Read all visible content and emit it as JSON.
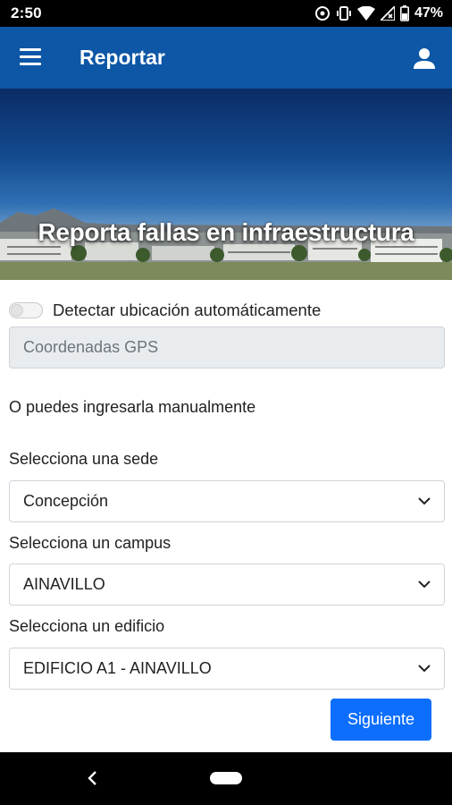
{
  "status_bar": {
    "time": "2:50",
    "battery": "47%",
    "icons": [
      "data-saver-icon",
      "vibrate-icon",
      "wifi-icon",
      "signal-icon",
      "battery-icon"
    ]
  },
  "app_bar": {
    "title": "Reportar",
    "left_icon": "menu-icon",
    "right_icon": "user-icon",
    "color": "#0d57a6"
  },
  "hero": {
    "title": "Reporta fallas en infraestructura"
  },
  "form": {
    "auto_location": {
      "label": "Detectar ubicación automáticamente",
      "enabled": false
    },
    "gps": {
      "placeholder": "Coordenadas GPS"
    },
    "manual_text": "O puedes ingresarla manualmente",
    "sede": {
      "label": "Selecciona una sede",
      "value": "Concepción"
    },
    "campus": {
      "label": "Selecciona un campus",
      "value": "AINAVILLO"
    },
    "edificio": {
      "label": "Selecciona un edificio",
      "value": "EDIFICIO A1 - AINAVILLO"
    },
    "next_label": "Siguiente",
    "accent": "#0d6efd"
  },
  "nav_bar": {
    "icons": [
      "back-icon",
      "home-pill-icon"
    ]
  }
}
